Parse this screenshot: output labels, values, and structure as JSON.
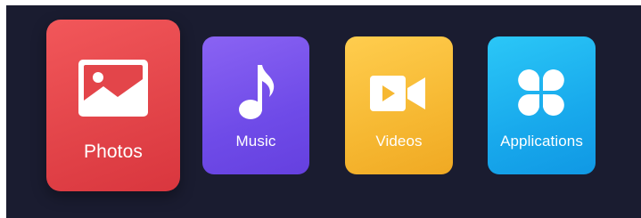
{
  "colors": {
    "background": "#1a1c30",
    "photos_tile": "#e3454a",
    "music_tile": "#6f4be8",
    "videos_tile": "#f6b832",
    "applications_tile": "#18a9ec",
    "icon": "#ffffff"
  },
  "tiles": [
    {
      "label": "Photos",
      "icon": "image-icon",
      "selected": true
    },
    {
      "label": "Music",
      "icon": "music-note-icon",
      "selected": false
    },
    {
      "label": "Videos",
      "icon": "video-camera-icon",
      "selected": false
    },
    {
      "label": "Applications",
      "icon": "four-petal-apps-icon",
      "selected": false
    }
  ]
}
